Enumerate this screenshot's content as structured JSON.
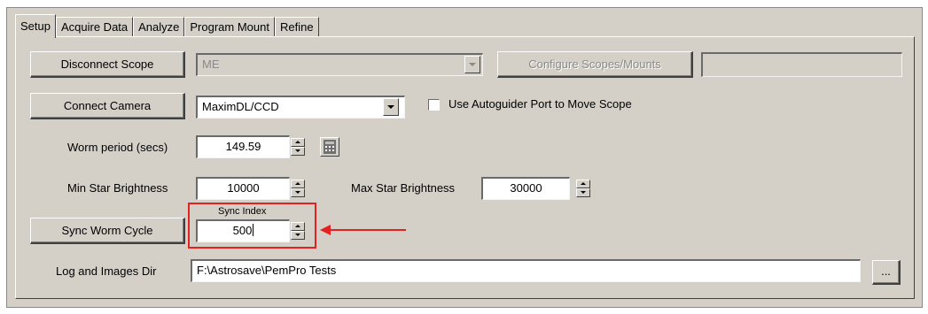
{
  "tabs": [
    {
      "label": "Setup",
      "active": true
    },
    {
      "label": "Acquire Data",
      "active": false
    },
    {
      "label": "Analyze",
      "active": false
    },
    {
      "label": "Program Mount",
      "active": false
    },
    {
      "label": "Refine",
      "active": false
    }
  ],
  "scope": {
    "disconnect_label": "Disconnect Scope",
    "selected": "ME",
    "configure_label": "Configure Scopes/Mounts",
    "extra_value": ""
  },
  "camera": {
    "connect_label": "Connect Camera",
    "selected": "MaximDL/CCD",
    "autoguider_label": "Use Autoguider Port to Move Scope",
    "autoguider_checked": false
  },
  "worm": {
    "label": "Worm period (secs)",
    "value": "149.59",
    "calculator_icon": "calculator-icon"
  },
  "brightness": {
    "min_label": "Min Star Brightness",
    "min_value": "10000",
    "max_label": "Max Star Brightness",
    "max_value": "30000"
  },
  "sync": {
    "button_label": "Sync Worm Cycle",
    "index_label": "Sync Index",
    "index_value": "500"
  },
  "log": {
    "label": "Log and Images Dir",
    "value": "F:\\Astrosave\\PemPro Tests",
    "browse_label": "..."
  },
  "colors": {
    "face": "#d4d0c8",
    "annotation": "#e52020"
  }
}
